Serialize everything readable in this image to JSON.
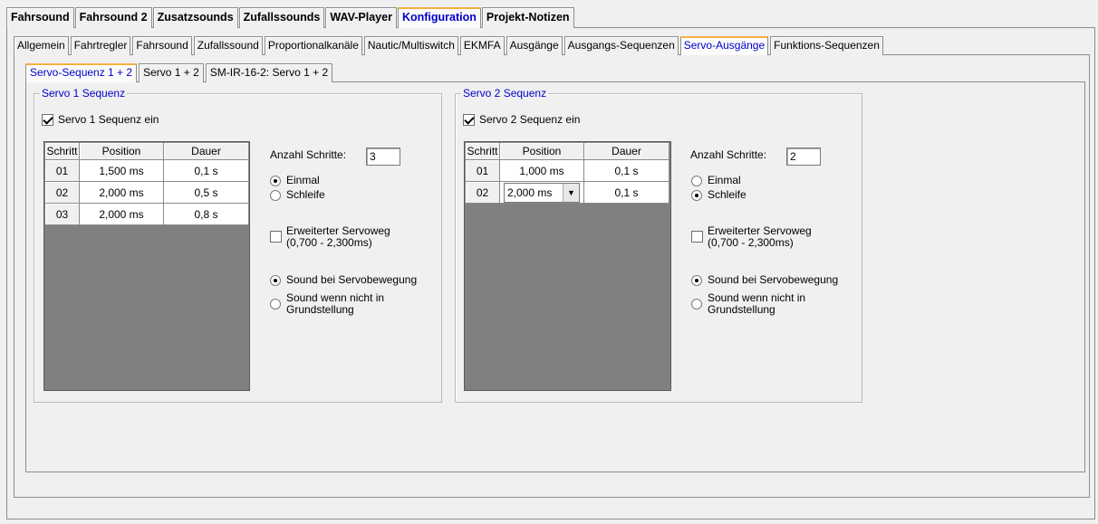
{
  "top_tabs": [
    "Fahrsound",
    "Fahrsound 2",
    "Zusatzsounds",
    "Zufallssounds",
    "WAV-Player",
    "Konfiguration",
    "Projekt-Notizen"
  ],
  "sub_tabs": [
    "Allgemein",
    "Fahrtregler",
    "Fahrsound",
    "Zufallssound",
    "Proportionalkanäle",
    "Nautic/Multiswitch",
    "EKMFA",
    "Ausgänge",
    "Ausgangs-Sequenzen",
    "Servo-Ausgänge",
    "Funktions-Sequenzen"
  ],
  "sub2_tabs": [
    "Servo-Sequenz 1 + 2",
    "Servo 1 + 2",
    "SM-IR-16-2: Servo 1 + 2"
  ],
  "active": {
    "top": "Konfiguration",
    "sub": "Servo-Ausgänge",
    "sub2": "Servo-Sequenz 1 + 2"
  },
  "colors": {
    "active_tab_text": "#0000cc",
    "tab_highlight": "#f5b13c",
    "grid_bg": "#808080"
  },
  "servo1": {
    "title": "Servo 1 Sequenz",
    "enable_label": "Servo 1 Sequenz ein",
    "enabled": true,
    "columns": [
      "Schritt",
      "Position",
      "Dauer"
    ],
    "rows": [
      {
        "step": "01",
        "position": "1,500 ms",
        "duration": "0,1 s"
      },
      {
        "step": "02",
        "position": "2,000 ms",
        "duration": "0,5 s"
      },
      {
        "step": "03",
        "position": "2,000 ms",
        "duration": "0,8 s"
      }
    ],
    "steps_label": "Anzahl Schritte:",
    "steps_value": "3",
    "mode_once": "Einmal",
    "mode_loop": "Schleife",
    "mode_selected": "once",
    "extended_label_1": "Erweiterter Servoweg",
    "extended_label_2": "(0,700 - 2,300ms)",
    "extended_checked": false,
    "sound_move": "Sound bei Servobewegung",
    "sound_not_home_1": "Sound wenn nicht in",
    "sound_not_home_2": "Grundstellung",
    "sound_selected": "move"
  },
  "servo2": {
    "title": "Servo 2 Sequenz",
    "enable_label": "Servo 2 Sequenz ein",
    "enabled": true,
    "columns": [
      "Schritt",
      "Position",
      "Dauer"
    ],
    "rows": [
      {
        "step": "01",
        "position": "1,000 ms",
        "duration": "0,1 s"
      },
      {
        "step": "02",
        "position": "2,000 ms",
        "duration": "0,1 s"
      }
    ],
    "steps_label": "Anzahl Schritte:",
    "steps_value": "2",
    "mode_once": "Einmal",
    "mode_loop": "Schleife",
    "mode_selected": "loop",
    "extended_label_1": "Erweiterter Servoweg",
    "extended_label_2": "(0,700 - 2,300ms)",
    "extended_checked": false,
    "sound_move": "Sound bei Servobewegung",
    "sound_not_home_1": "Sound wenn nicht in",
    "sound_not_home_2": "Grundstellung",
    "sound_selected": "move"
  }
}
